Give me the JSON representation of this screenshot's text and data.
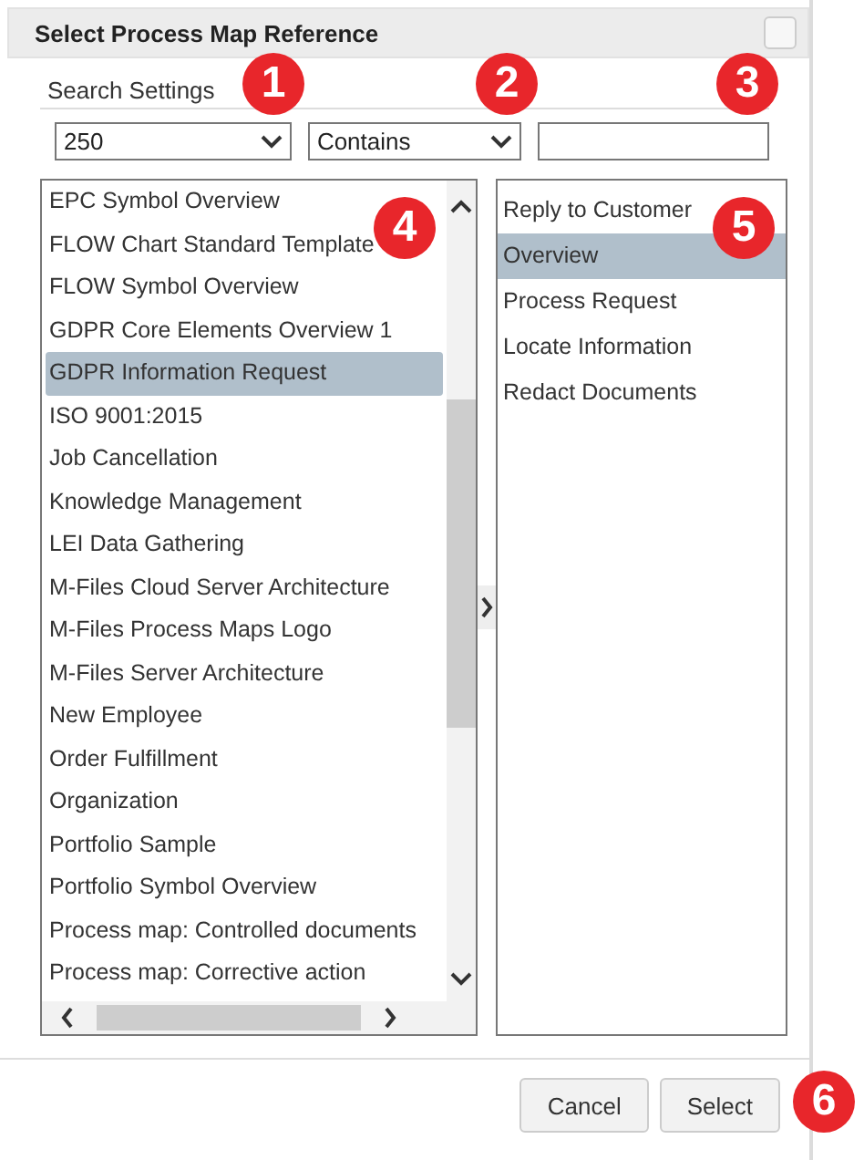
{
  "dialog": {
    "title": "Select Process Map Reference",
    "checked": false
  },
  "search_settings": {
    "label": "Search Settings",
    "limit": "250",
    "match": "Contains"
  },
  "maps": [
    {
      "label": "EPC Symbol Overview",
      "selected": false
    },
    {
      "label": "FLOW Chart Standard Template",
      "selected": false
    },
    {
      "label": "FLOW Symbol Overview",
      "selected": false
    },
    {
      "label": "GDPR Core Elements Overview 1",
      "selected": false
    },
    {
      "label": "GDPR Information Request",
      "selected": true
    },
    {
      "label": "ISO 9001:2015",
      "selected": false
    },
    {
      "label": "Job Cancellation",
      "selected": false
    },
    {
      "label": "Knowledge Management",
      "selected": false
    },
    {
      "label": "LEI Data Gathering",
      "selected": false
    },
    {
      "label": "M-Files Cloud Server Architecture",
      "selected": false
    },
    {
      "label": "M-Files Process Maps Logo",
      "selected": false
    },
    {
      "label": "M-Files Server Architecture",
      "selected": false
    },
    {
      "label": "New Employee",
      "selected": false
    },
    {
      "label": "Order Fulfillment",
      "selected": false
    },
    {
      "label": "Organization",
      "selected": false
    },
    {
      "label": "Portfolio Sample",
      "selected": false
    },
    {
      "label": "Portfolio Symbol Overview",
      "selected": false
    },
    {
      "label": "Process map: Controlled documents",
      "selected": false
    },
    {
      "label": "Process map: Corrective action",
      "selected": false
    }
  ],
  "pages": [
    {
      "label": "Reply to Customer",
      "selected": false
    },
    {
      "label": "Overview",
      "selected": true
    },
    {
      "label": "Process Request",
      "selected": false
    },
    {
      "label": "Locate Information",
      "selected": false
    },
    {
      "label": "Redact Documents",
      "selected": false
    }
  ],
  "buttons": [
    "Cancel",
    "Select"
  ],
  "callouts": [
    "1",
    "2",
    "3",
    "4",
    "5",
    "6"
  ]
}
